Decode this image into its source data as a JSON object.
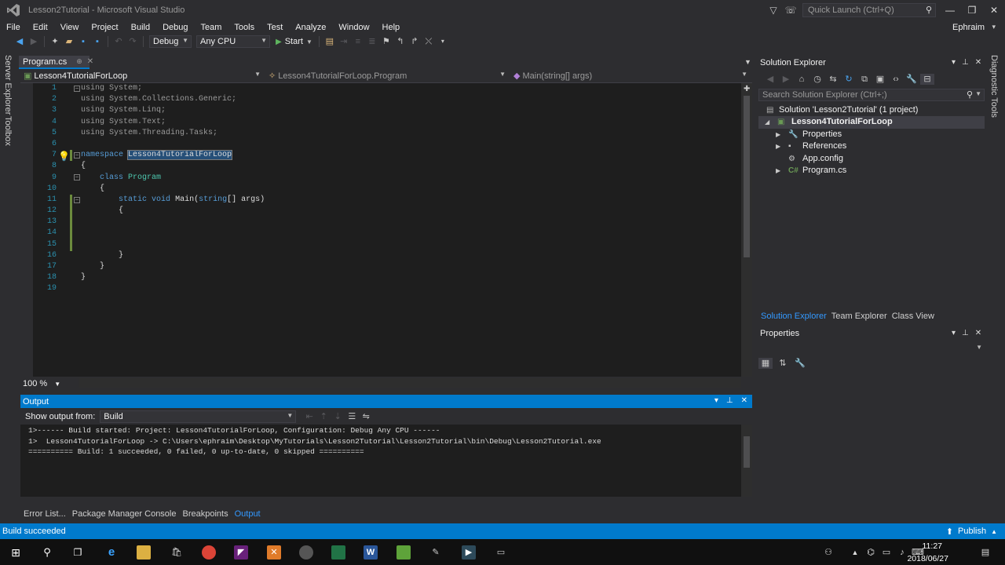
{
  "window": {
    "title": "Lesson2Tutorial - Microsoft Visual Studio",
    "quick_launch_placeholder": "Quick Launch (Ctrl+Q)",
    "user": "Ephraim"
  },
  "menu": [
    "File",
    "Edit",
    "View",
    "Project",
    "Build",
    "Debug",
    "Team",
    "Tools",
    "Test",
    "Analyze",
    "Window",
    "Help"
  ],
  "toolbar": {
    "config": "Debug",
    "platform": "Any CPU",
    "start_label": "Start"
  },
  "left_tabs": [
    "Server Explorer",
    "Toolbox"
  ],
  "editor": {
    "tab_label": "Program.cs",
    "nav_project": "Lesson4TutorialForLoop",
    "nav_class": "Lesson4TutorialForLoop.Program",
    "nav_member": "Main(string[] args)",
    "zoom": "100 %",
    "line_numbers": [
      "1",
      "2",
      "3",
      "4",
      "5",
      "6",
      "7",
      "8",
      "9",
      "10",
      "11",
      "12",
      "13",
      "14",
      "15",
      "16",
      "17",
      "18",
      "19"
    ],
    "code": {
      "l1_kw": "using",
      "l1_rest": " System;",
      "l2_kw": "using",
      "l2_rest": " System.Collections.Generic;",
      "l3_kw": "using",
      "l3_rest": " System.Linq;",
      "l4_kw": "using",
      "l4_rest": " System.Text;",
      "l5_kw": "using",
      "l5_rest": " System.Threading.Tasks;",
      "l7_kw": "namespace",
      "l7_name": "Lesson4TutorialForLoop",
      "l8": "{",
      "l9_kw": "class",
      "l9_name": "Program",
      "l10": "{",
      "l11_kw1": "static",
      "l11_kw2": "void",
      "l11_name": "Main(",
      "l11_kw3": "string",
      "l11_rest": "[] args)",
      "l12": "{",
      "l16": "}",
      "l17": "}",
      "l18": "}"
    }
  },
  "output": {
    "title": "Output",
    "show_output_label": "Show output from:",
    "source": "Build",
    "lines": [
      "1>------ Build started: Project: Lesson4TutorialForLoop, Configuration: Debug Any CPU ------",
      "1>  Lesson4TutorialForLoop -> C:\\Users\\ephraim\\Desktop\\MyTutorials\\Lesson2Tutorial\\Lesson2Tutorial\\bin\\Debug\\Lesson2Tutorial.exe",
      "========== Build: 1 succeeded, 0 failed, 0 up-to-date, 0 skipped =========="
    ]
  },
  "bottom_tabs": [
    "Error List...",
    "Package Manager Console",
    "Breakpoints",
    "Output"
  ],
  "solution_explorer": {
    "title": "Solution Explorer",
    "search_placeholder": "Search Solution Explorer (Ctrl+;)",
    "solution": "Solution 'Lesson2Tutorial' (1 project)",
    "project": "Lesson4TutorialForLoop",
    "items": [
      "Properties",
      "References",
      "App.config",
      "Program.cs"
    ],
    "tabs": [
      "Solution Explorer",
      "Team Explorer",
      "Class View"
    ]
  },
  "right_tabs": [
    "Diagnostic Tools"
  ],
  "properties": {
    "title": "Properties"
  },
  "status": {
    "text": "Build succeeded",
    "publish": "Publish"
  },
  "clock": {
    "time": "11:27",
    "date": "2018/06/27"
  },
  "colors": {
    "accent": "#007acc",
    "editor_bg": "#1e1e1e",
    "keyword": "#569cd6",
    "type": "#4ec9b0"
  }
}
